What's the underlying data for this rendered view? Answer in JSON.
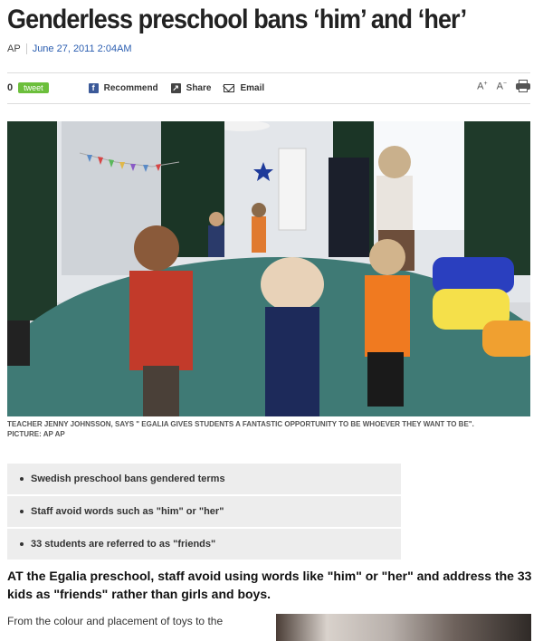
{
  "article": {
    "headline": "Genderless preschool bans ‘him’ and ‘her’",
    "source": "AP",
    "date": "June 27, 2011 2:04AM"
  },
  "share_bar": {
    "count": "0",
    "tweet_label": "tweet",
    "recommend_label": "Recommend",
    "share_label": "Share",
    "email_label": "Email",
    "font_increase": "A",
    "font_decrease": "A",
    "icons": [
      "facebook-icon",
      "share-icon",
      "email-icon",
      "print-icon"
    ]
  },
  "photo": {
    "caption_line1": "TEACHER JENNY JOHNSSON, SAYS \" EGALIA GIVES STUDENTS A FANTASTIC OPPORTUNITY TO BE WHOEVER THEY WANT TO BE\".",
    "caption_line2": "PICTURE: AP AP"
  },
  "highlights": [
    "Swedish preschool bans gendered terms",
    "Staff avoid words such as \"him\" or \"her\"",
    "33 students are referred to as \"friends\""
  ],
  "intro": "AT the Egalia preschool, staff avoid using words like \"him\" or \"her\" and address the 33 kids as \"friends\" rather than girls and boys.",
  "body_start": "From the colour and placement of toys to the"
}
